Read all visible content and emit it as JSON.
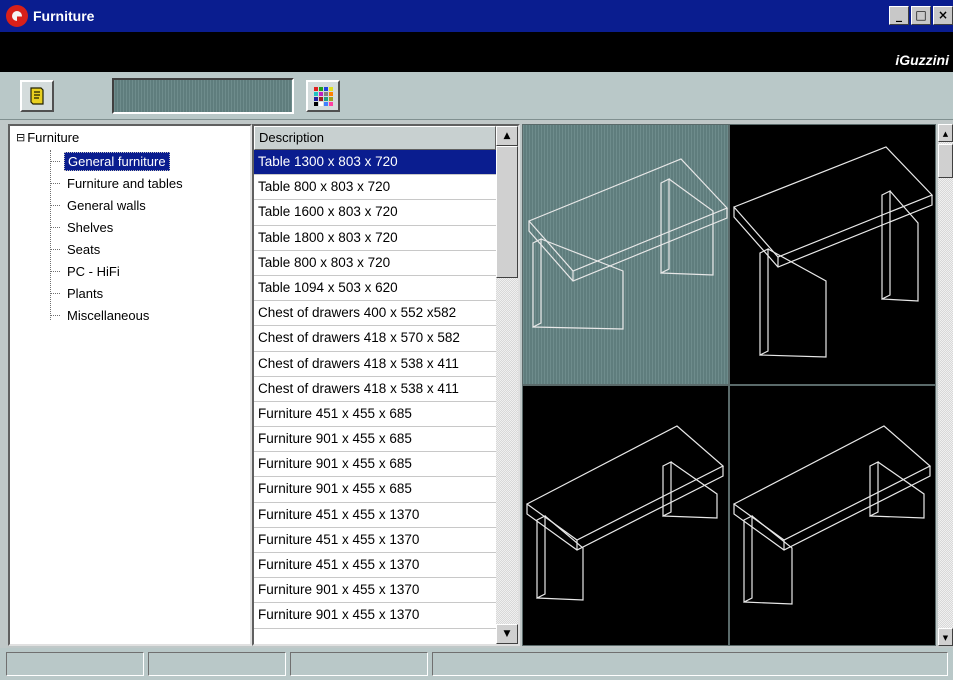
{
  "window": {
    "title": "Furniture",
    "brand": "iGuzzini",
    "controls": [
      "_",
      "□",
      "×"
    ]
  },
  "toolbar": {
    "buttons": [
      {
        "icon": "document-icon"
      },
      {
        "icon": "color-palette-icon"
      }
    ],
    "field_value": ""
  },
  "tree": {
    "root": {
      "toggle": "⊟",
      "label": "Furniture"
    },
    "items": [
      {
        "label": "General furniture",
        "selected": true
      },
      {
        "label": "Furniture and tables",
        "selected": false
      },
      {
        "label": "General walls",
        "selected": false
      },
      {
        "label": "Shelves",
        "selected": false
      },
      {
        "label": "Seats",
        "selected": false
      },
      {
        "label": "PC - HiFi",
        "selected": false
      },
      {
        "label": "Plants",
        "selected": false
      },
      {
        "label": "Miscellaneous",
        "selected": false
      }
    ]
  },
  "list": {
    "header": "Description",
    "rows": [
      "Table 1300 x 803 x 720",
      "Table 800 x 803 x 720",
      "Table 1600 x 803 x 720",
      "Table 1800 x 803 x 720",
      "Table 800 x 803 x 720",
      "Table 1094 x 503 x 620",
      "Chest of drawers 400 x 552 x582",
      "Chest of drawers 418 x 570 x 582",
      "Chest of drawers 418 x 538 x 411",
      "Chest of drawers 418 x 538 x 411",
      "Furniture 451 x 455 x 685",
      "Furniture 901 x 455 x 685",
      "Furniture 901 x 455 x 685",
      "Furniture 901 x 455 x 685",
      "Furniture 451 x 455 x 1370",
      "Furniture 451 x 455 x 1370",
      "Furniture 451 x 455 x 1370",
      "Furniture 901 x 455 x 1370",
      "Furniture 901 x 455 x 1370"
    ],
    "selected_index": 0
  },
  "preview": {
    "thumbnails": [
      "table-wireframe",
      "table-wireframe",
      "table-wireframe",
      "table-wireframe"
    ],
    "selected_index": 0
  },
  "colors": {
    "titlebar": "#0a1d8f",
    "selection": "#0a1d8f",
    "panel_bg": "#b9c8c8",
    "preview_bg": "#000000",
    "selected_cell": "#6a8888"
  }
}
